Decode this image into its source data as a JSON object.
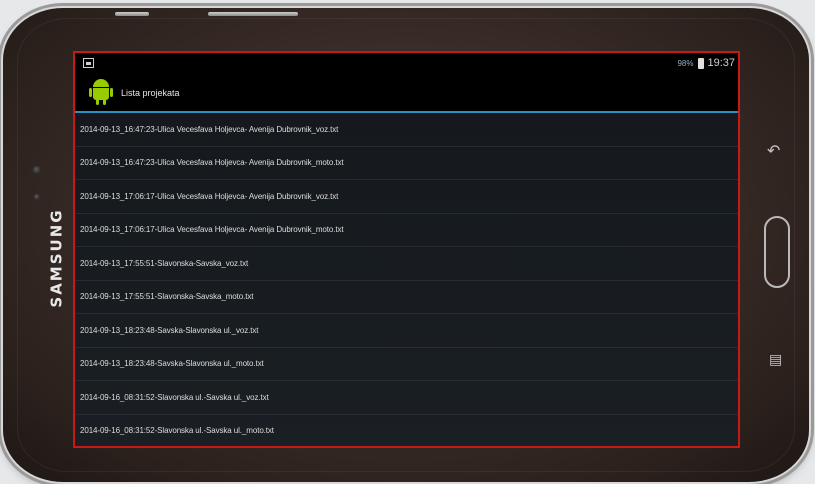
{
  "device": {
    "brand": "SAMSUNG"
  },
  "status_bar": {
    "battery": "98%",
    "time": "19:37"
  },
  "action_bar": {
    "title": "Lista projekata",
    "icon": "android-icon"
  },
  "files": [
    "2014-09-13_16:47:23-Ulica Vecesfava Holjevca- Avenija Dubrovnik_voz.txt",
    "2014-09-13_16:47:23-Ulica Vecesfava Holjevca- Avenija Dubrovnik_moto.txt",
    "2014-09-13_17:06:17-Ulica Vecesfava Holjevca- Avenija Dubrovnik_voz.txt",
    "2014-09-13_17:06:17-Ulica Vecesfava Holjevca- Avenija Dubrovnik_moto.txt",
    "2014-09-13_17:55:51-Slavonska-Savska_voz.txt",
    "2014-09-13_17:55:51-Slavonska-Savska_moto.txt",
    "2014-09-13_18:23:48-Savska-Slavonska ul._voz.txt",
    "2014-09-13_18:23:48-Savska-Slavonska ul._moto.txt",
    "2014-09-16_08:31:52-Slavonska ul.-Savska ul._voz.txt",
    "2014-09-16_08:31:52-Slavonska ul.-Savska ul._moto.txt"
  ],
  "colors": {
    "highlight_border": "#c81818",
    "action_bar_divider": "#2c8fbf",
    "android_green": "#99cc00"
  }
}
